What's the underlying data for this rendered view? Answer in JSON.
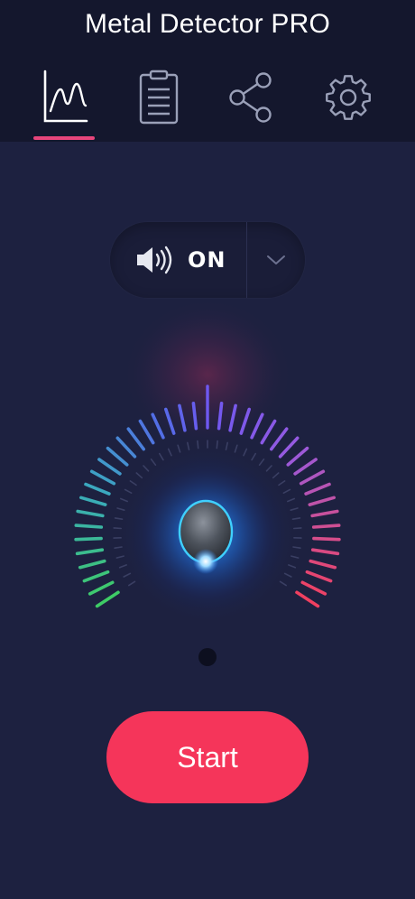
{
  "app": {
    "title": "Metal Detector PRO"
  },
  "tabs": [
    {
      "name": "graph",
      "icon": "graph-icon",
      "active": true
    },
    {
      "name": "history",
      "icon": "clipboard-icon",
      "active": false
    },
    {
      "name": "share",
      "icon": "share-icon",
      "active": false
    },
    {
      "name": "settings",
      "icon": "gear-icon",
      "active": false
    }
  ],
  "sound": {
    "label": "ON",
    "icon": "speaker-icon",
    "dropdown_icon": "chevron-down-icon"
  },
  "gauge": {
    "level": 0,
    "indicator_icon": "needle-knob-icon"
  },
  "actions": {
    "start_label": "Start"
  },
  "colors": {
    "accent": "#e8457b",
    "start": "#f5355a",
    "background": "#1d2140",
    "header": "#14172d",
    "glow": "#2f8bff"
  }
}
